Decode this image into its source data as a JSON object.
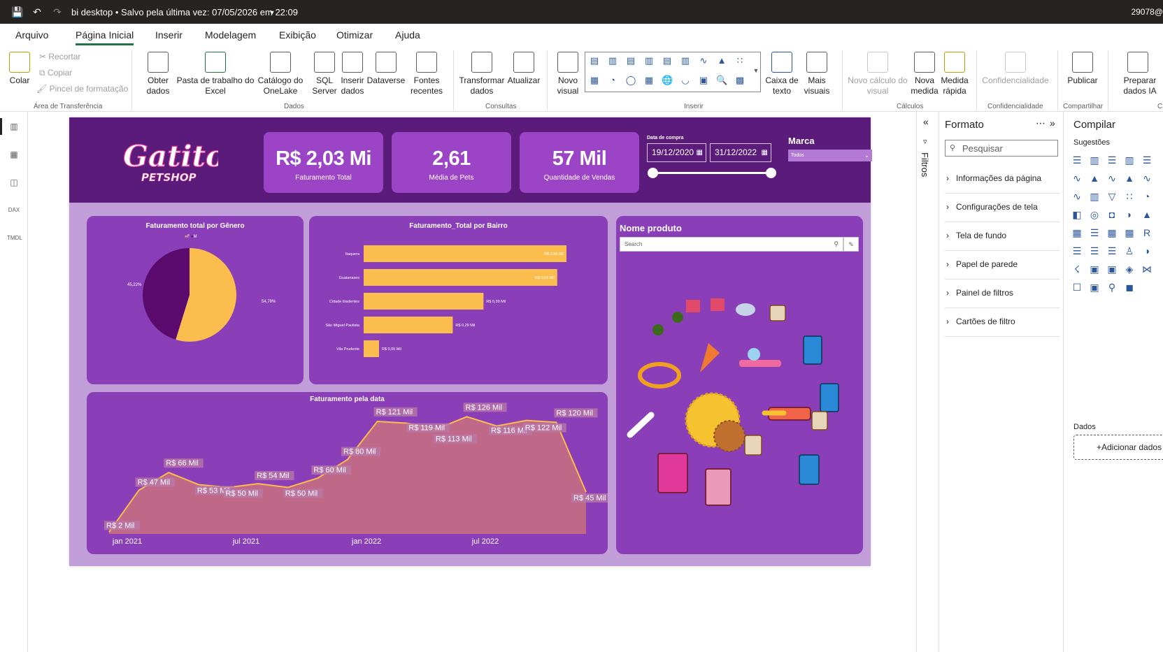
{
  "titlebar": {
    "title": "bi desktop • Salvo pela última vez: 07/05/2026 em 22:09",
    "user": "29078@"
  },
  "menu": {
    "tabs": [
      "Arquivo",
      "Página Inicial",
      "Inserir",
      "Modelagem",
      "Exibição",
      "Otimizar",
      "Ajuda"
    ],
    "active": "Página Inicial"
  },
  "ribbon": {
    "paste": "Colar",
    "cut": "Recortar",
    "copy": "Copiar",
    "format_painter": "Pincel de formatação",
    "clipboard_group": "Área de Transferência",
    "get_data": "Obter dados",
    "excel": "Pasta de trabalho do Excel",
    "onelake": "Catálogo do OneLake",
    "sql": "SQL Server",
    "enter_data": "Inserir dados",
    "dataverse": "Dataverse",
    "recent": "Fontes recentes",
    "data_group": "Dados",
    "transform": "Transformar dados",
    "refresh": "Atualizar",
    "queries_group": "Consultas",
    "new_visual": "Novo visual",
    "text_box": "Caixa de texto",
    "more_visuals": "Mais visuais",
    "insert_group": "Inserir",
    "new_calc": "Novo cálculo do visual",
    "new_measure": "Nova medida",
    "quick_measure": "Medida rápida",
    "calc_group": "Cálculos",
    "sensitivity": "Confidencialidade",
    "sensitivity_group": "Confidencialidade",
    "publish": "Publicar",
    "share_group": "Compartilhar",
    "prepare_ai": "Preparar dados IA",
    "last_group": "C"
  },
  "report": {
    "logo_main": "Gatito",
    "logo_sub": "PETSHOP",
    "kpis": [
      {
        "value": "R$ 2,03 Mi",
        "label": "Faturamento Total"
      },
      {
        "value": "2,61",
        "label": "Média de Pets"
      },
      {
        "value": "57 Mil",
        "label": "Quantidade de Vendas"
      }
    ],
    "date_slicer": {
      "title": "Data de compra",
      "start": "19/12/2020",
      "end": "31/12/2022"
    },
    "brand_slicer": {
      "title": "Marca",
      "value": "Todos"
    },
    "product_slicer": {
      "title": "Nome produto",
      "search_placeholder": "Search"
    }
  },
  "chart_data": [
    {
      "type": "pie",
      "title": "Faturamento total por Gênero",
      "legend": [
        "F",
        "M"
      ],
      "series": [
        {
          "name": "F",
          "value": 54.78,
          "label": "54,78%",
          "color": "#fbbd4d"
        },
        {
          "name": "M",
          "value": 45.22,
          "label": "45,22%",
          "color": "#5b0a6e"
        }
      ]
    },
    {
      "type": "bar",
      "orientation": "horizontal",
      "title": "Faturamento_Total por Bairro",
      "categories": [
        "Itaquera",
        "Guaianases",
        "Cidade tiradentes",
        "São Miguel Paulista",
        "Vila Prudente"
      ],
      "values": [
        0.66,
        0.63,
        0.39,
        0.29,
        0.05
      ],
      "labels": [
        "R$ 0,66 Mil",
        "R$ 0,63 Mil",
        "R$ 0,39 Mil",
        "R$ 0,29 Mil",
        "R$ 0,05 Mil"
      ],
      "color": "#fbbd4d"
    },
    {
      "type": "area",
      "title": "Faturamento pela data",
      "x_ticks": [
        "jan 2021",
        "jul 2021",
        "jan 2022",
        "jul 2022"
      ],
      "values": [
        2,
        47,
        66,
        53,
        50,
        54,
        50,
        60,
        80,
        121,
        119,
        113,
        126,
        116,
        122,
        120,
        45
      ],
      "labels": [
        "R$ 2 Mil",
        "R$ 47 Mil",
        "R$ 66 Mil",
        "R$ 53 Mil",
        "R$ 50 Mil",
        "R$ 54 Mil",
        "R$ 50 Mil",
        "R$ 60 Mil",
        "R$ 80 Mil",
        "R$ 121 Mil",
        "R$ 119 Mil",
        "R$ 113 Mil",
        "R$ 126 Mil",
        "R$ 116 Mil",
        "R$ 122 Mil",
        "R$ 120 Mil",
        "R$ 45 Mil"
      ],
      "ylim": [
        0,
        130
      ],
      "line_color": "#fbbd4d",
      "fill_color": "#c9707f"
    }
  ],
  "filters_pane": {
    "label": "Filtros"
  },
  "format_pane": {
    "title": "Formato",
    "search_placeholder": "Pesquisar",
    "items": [
      "Informações da página",
      "Configurações de tela",
      "Tela de fundo",
      "Papel de parede",
      "Painel de filtros",
      "Cartões de filtro"
    ]
  },
  "build_pane": {
    "title": "Compilar",
    "suggestions": "Sugestões",
    "data_label": "Dados",
    "add_data": "+Adicionar dados"
  }
}
